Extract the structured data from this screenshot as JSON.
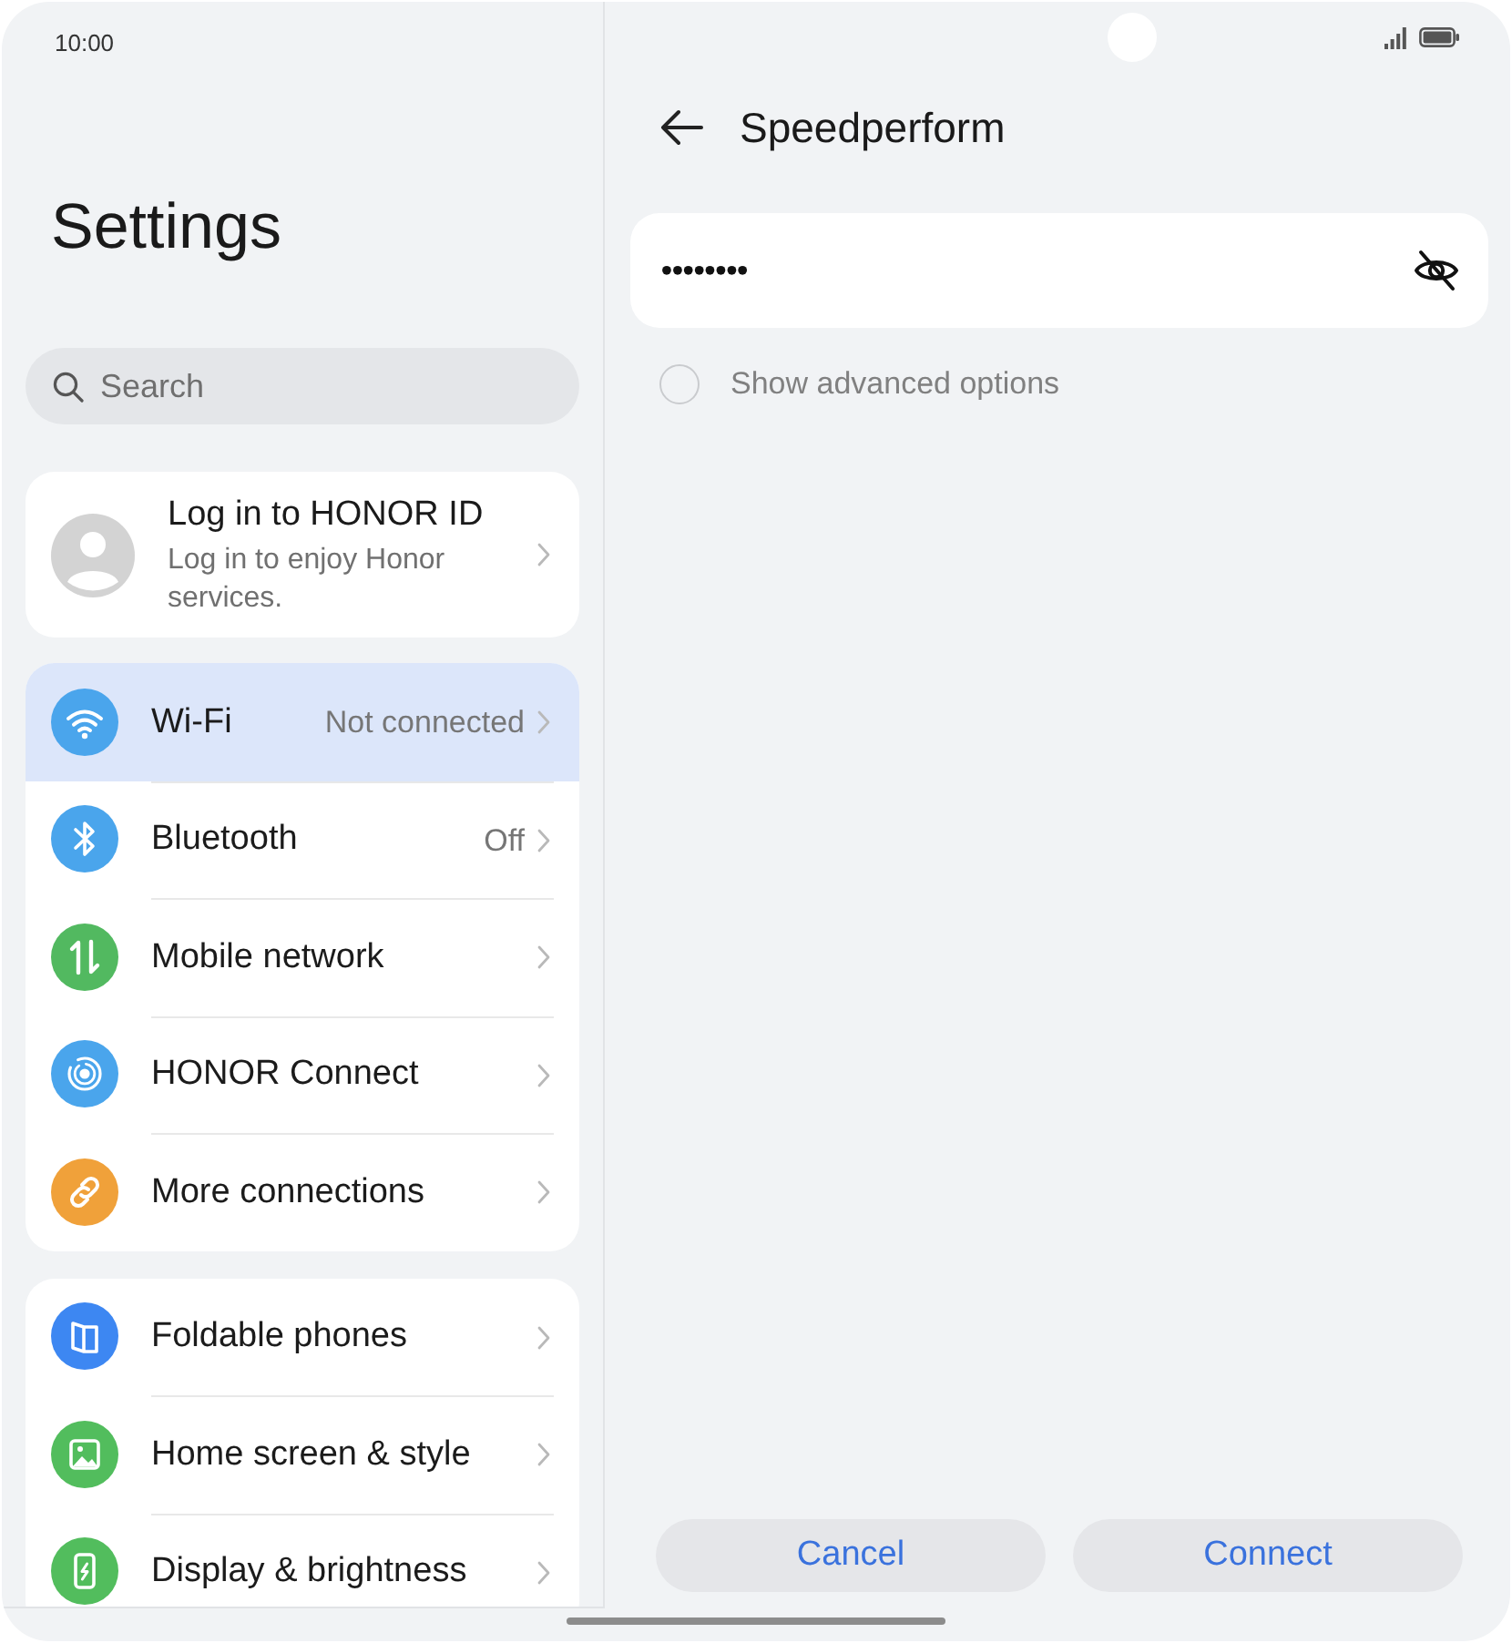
{
  "status_bar": {
    "time": "10:00"
  },
  "settings": {
    "title": "Settings",
    "search": {
      "placeholder": "Search"
    },
    "account": {
      "title": "Log in to HONOR ID",
      "subtitle": "Log in to enjoy Honor services."
    },
    "groups": [
      {
        "items": [
          {
            "label": "Wi-Fi",
            "value": "Not connected",
            "color": "#4aa5ec",
            "selected": true
          },
          {
            "label": "Bluetooth",
            "value": "Off",
            "color": "#4aa5ec",
            "selected": false
          },
          {
            "label": "Mobile network",
            "color": "#52b960",
            "selected": false
          },
          {
            "label": "HONOR Connect",
            "color": "#4aa5ec",
            "selected": false
          },
          {
            "label": "More connections",
            "color": "#f0a13a",
            "selected": false
          }
        ]
      },
      {
        "items": [
          {
            "label": "Foldable phones",
            "color": "#3d87f2",
            "selected": false
          },
          {
            "label": "Home screen & style",
            "color": "#52bd5d",
            "selected": false
          },
          {
            "label": "Display & brightness",
            "color": "#52bd5d",
            "selected": false
          }
        ]
      }
    ]
  },
  "wifi_dialog": {
    "title": "Speedperform",
    "password": {
      "value": "••••••••"
    },
    "advanced_options": {
      "label": "Show advanced options",
      "checked": false
    },
    "buttons": [
      {
        "label": "Cancel"
      },
      {
        "label": "Connect"
      }
    ]
  }
}
